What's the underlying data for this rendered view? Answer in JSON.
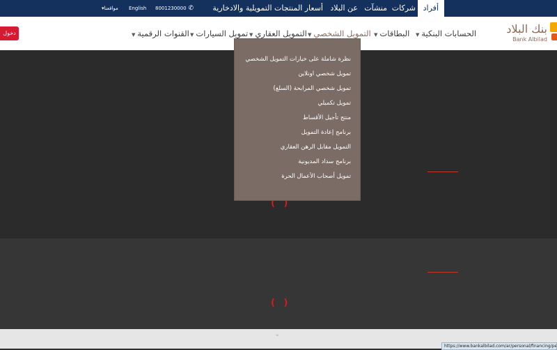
{
  "topbar": {
    "tab_individuals": "أفراد",
    "link_companies": "شركات",
    "link_establishments": "منشآت",
    "link_about": "عن البلاد",
    "link_prices": "أسعار المنتجات التمويلية والادخارية",
    "phone": "8001230000",
    "language": "English",
    "locations": "مواقعنا"
  },
  "nav": {
    "bank_accounts": "الحسابات البنكية",
    "cards": "البطاقات",
    "personal_finance": "التمويل الشخصي",
    "real_estate_finance": "التمويل العقاري",
    "auto_finance": "تمويل السيارات",
    "digital_channels": "القنوات الرقمية"
  },
  "login_label": "دخول",
  "logo": {
    "arabic": "بنك البلاد",
    "english": "Bank Albilad"
  },
  "dropdown": {
    "items": [
      "نظرة شاملة على خيارات التمويل الشخصي",
      "تمويل شخصي اونلاين",
      "تمويل شخصي المرابحة (السلع)",
      "تمويل تكميلي",
      "منتج تأجيل الأقساط",
      "برنامج إعادة التمويل",
      "التمويل مقابل الرهن العقاري",
      "برنامج سداد المديونية",
      "تمويل أصحاب الأعمال الحرة"
    ]
  },
  "spinner_glyph": "( )",
  "status_url": "https://www.bankalbilad.com/ar/personal/financing/personal/Pages",
  "colors": {
    "topbar": "#13315c",
    "dropdown": "#7b6c65",
    "accent_red": "#d51a32",
    "brand_brown": "#8b6b5b"
  }
}
